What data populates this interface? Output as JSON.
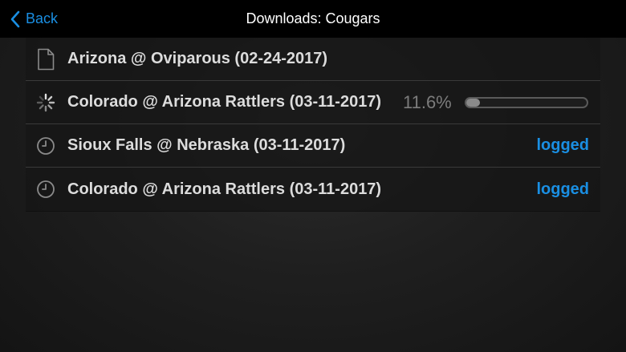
{
  "nav": {
    "back_label": "Back",
    "title": "Downloads: Cougars"
  },
  "downloads": [
    {
      "title": "Arizona @ Oviparous (02-24-2017)",
      "icon": "document-icon",
      "state": "complete"
    },
    {
      "title": "Colorado @ Arizona Rattlers (03-11-2017)",
      "icon": "spinner-icon",
      "state": "downloading",
      "percent_text": "11.6%",
      "progress": 0.116
    },
    {
      "title": "Sioux Falls @ Nebraska (03-11-2017)",
      "icon": "clock-icon",
      "state": "queued",
      "status": "logged"
    },
    {
      "title": "Colorado @ Arizona Rattlers (03-11-2017)",
      "icon": "clock-icon",
      "state": "queued",
      "status": "logged"
    }
  ],
  "colors": {
    "accent": "#1a8fe3",
    "navbar": "#000000"
  }
}
